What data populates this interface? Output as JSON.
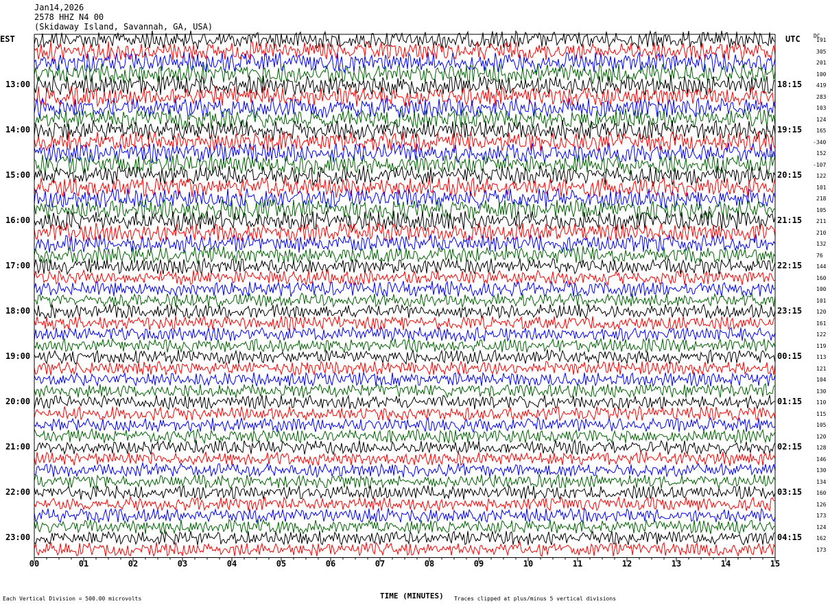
{
  "header": {
    "date": "Jan14,2026",
    "station": "2578 HHZ N4 00",
    "location": "(Skidaway Island, Savannah, GA, USA)"
  },
  "left_tz": "EST",
  "right_tz": "UTC",
  "dc_label": "DC",
  "xlabel": "TIME (MINUTES)",
  "footer_left": "Each Vertical Division = 500.00 microvolts",
  "footer_right": "Traces clipped at plus/minus 5 vertical divisions",
  "colors": {
    "black": "#000000",
    "red": "#ff0000",
    "blue": "#0000ff",
    "green": "#006400"
  },
  "chart_data": {
    "type": "line",
    "subtype": "helicorder",
    "x": {
      "min": 0,
      "max": 15,
      "ticks": [
        "00",
        "01",
        "02",
        "03",
        "04",
        "05",
        "06",
        "07",
        "08",
        "09",
        "10",
        "11",
        "12",
        "13",
        "14",
        "15"
      ]
    },
    "rows_per_hour": 4,
    "left_hour_labels": [
      "13:00",
      "14:00",
      "15:00",
      "16:00",
      "17:00",
      "18:00",
      "19:00",
      "20:00",
      "21:00",
      "22:00",
      "23:00"
    ],
    "right_hour_labels": [
      "18:15",
      "19:15",
      "20:15",
      "21:15",
      "22:15",
      "23:15",
      "00:15",
      "01:15",
      "02:15",
      "03:15",
      "04:15"
    ],
    "first_label_row": 4,
    "trace_color_cycle": [
      "black",
      "red",
      "blue",
      "green"
    ],
    "dc_offsets": [
      191,
      305,
      201,
      100,
      419,
      283,
      103,
      124,
      165,
      -340,
      152,
      -107,
      122,
      101,
      218,
      105,
      211,
      210,
      132,
      76,
      144,
      160,
      100,
      101,
      120,
      161,
      122,
      119,
      113,
      121,
      104,
      130,
      110,
      115,
      105,
      120,
      128,
      146,
      130,
      134,
      160,
      126,
      173,
      124,
      162,
      173
    ],
    "noise_level": [
      0.9,
      0.95,
      1.0,
      1.0,
      1.0,
      1.0,
      1.0,
      1.0,
      1.0,
      1.0,
      1.0,
      1.0,
      1.0,
      1.0,
      1.0,
      1.0,
      1.0,
      0.95,
      0.9,
      0.85,
      0.8,
      0.75,
      0.75,
      0.7,
      0.7,
      0.7,
      0.7,
      0.7,
      0.7,
      0.7,
      0.7,
      0.7,
      0.7,
      0.7,
      0.7,
      0.7,
      0.7,
      0.7,
      0.7,
      0.7,
      0.7,
      0.7,
      0.7,
      0.7,
      0.7,
      0.7
    ]
  }
}
